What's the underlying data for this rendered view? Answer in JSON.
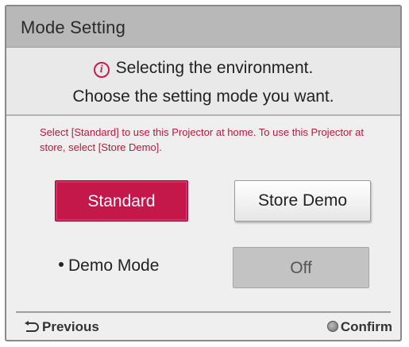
{
  "dialog": {
    "title": "Mode Setting",
    "message_line1": "Selecting the environment.",
    "message_line2": "Choose the setting mode you want.",
    "hint": "Select [Standard] to use this Projector at home. To use this Projector at store, select [Store Demo]."
  },
  "mode_buttons": {
    "standard_label": "Standard",
    "store_demo_label": "Store Demo",
    "selected": "Standard"
  },
  "demo_mode": {
    "label": "Demo Mode",
    "value": "Off"
  },
  "footer": {
    "previous_label": "Previous",
    "confirm_label": "Confirm"
  },
  "icons": {
    "info": "info-icon",
    "back": "return-arrow-icon",
    "confirm": "ok-button-icon"
  },
  "colors": {
    "accent": "#c4174a",
    "hint_text": "#b31b3a",
    "title_bar": "#b8b8b8"
  }
}
